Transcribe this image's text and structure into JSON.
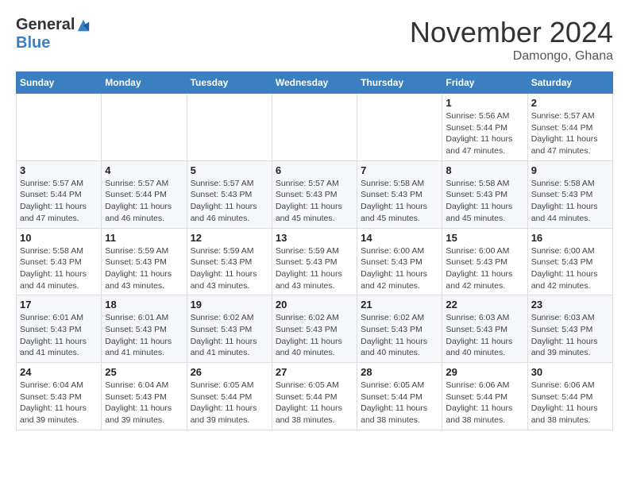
{
  "header": {
    "logo_general": "General",
    "logo_blue": "Blue",
    "month_title": "November 2024",
    "location": "Damongo, Ghana"
  },
  "days_of_week": [
    "Sunday",
    "Monday",
    "Tuesday",
    "Wednesday",
    "Thursday",
    "Friday",
    "Saturday"
  ],
  "weeks": [
    [
      {
        "day": "",
        "info": ""
      },
      {
        "day": "",
        "info": ""
      },
      {
        "day": "",
        "info": ""
      },
      {
        "day": "",
        "info": ""
      },
      {
        "day": "",
        "info": ""
      },
      {
        "day": "1",
        "info": "Sunrise: 5:56 AM\nSunset: 5:44 PM\nDaylight: 11 hours and 47 minutes."
      },
      {
        "day": "2",
        "info": "Sunrise: 5:57 AM\nSunset: 5:44 PM\nDaylight: 11 hours and 47 minutes."
      }
    ],
    [
      {
        "day": "3",
        "info": "Sunrise: 5:57 AM\nSunset: 5:44 PM\nDaylight: 11 hours and 47 minutes."
      },
      {
        "day": "4",
        "info": "Sunrise: 5:57 AM\nSunset: 5:44 PM\nDaylight: 11 hours and 46 minutes."
      },
      {
        "day": "5",
        "info": "Sunrise: 5:57 AM\nSunset: 5:43 PM\nDaylight: 11 hours and 46 minutes."
      },
      {
        "day": "6",
        "info": "Sunrise: 5:57 AM\nSunset: 5:43 PM\nDaylight: 11 hours and 45 minutes."
      },
      {
        "day": "7",
        "info": "Sunrise: 5:58 AM\nSunset: 5:43 PM\nDaylight: 11 hours and 45 minutes."
      },
      {
        "day": "8",
        "info": "Sunrise: 5:58 AM\nSunset: 5:43 PM\nDaylight: 11 hours and 45 minutes."
      },
      {
        "day": "9",
        "info": "Sunrise: 5:58 AM\nSunset: 5:43 PM\nDaylight: 11 hours and 44 minutes."
      }
    ],
    [
      {
        "day": "10",
        "info": "Sunrise: 5:58 AM\nSunset: 5:43 PM\nDaylight: 11 hours and 44 minutes."
      },
      {
        "day": "11",
        "info": "Sunrise: 5:59 AM\nSunset: 5:43 PM\nDaylight: 11 hours and 43 minutes."
      },
      {
        "day": "12",
        "info": "Sunrise: 5:59 AM\nSunset: 5:43 PM\nDaylight: 11 hours and 43 minutes."
      },
      {
        "day": "13",
        "info": "Sunrise: 5:59 AM\nSunset: 5:43 PM\nDaylight: 11 hours and 43 minutes."
      },
      {
        "day": "14",
        "info": "Sunrise: 6:00 AM\nSunset: 5:43 PM\nDaylight: 11 hours and 42 minutes."
      },
      {
        "day": "15",
        "info": "Sunrise: 6:00 AM\nSunset: 5:43 PM\nDaylight: 11 hours and 42 minutes."
      },
      {
        "day": "16",
        "info": "Sunrise: 6:00 AM\nSunset: 5:43 PM\nDaylight: 11 hours and 42 minutes."
      }
    ],
    [
      {
        "day": "17",
        "info": "Sunrise: 6:01 AM\nSunset: 5:43 PM\nDaylight: 11 hours and 41 minutes."
      },
      {
        "day": "18",
        "info": "Sunrise: 6:01 AM\nSunset: 5:43 PM\nDaylight: 11 hours and 41 minutes."
      },
      {
        "day": "19",
        "info": "Sunrise: 6:02 AM\nSunset: 5:43 PM\nDaylight: 11 hours and 41 minutes."
      },
      {
        "day": "20",
        "info": "Sunrise: 6:02 AM\nSunset: 5:43 PM\nDaylight: 11 hours and 40 minutes."
      },
      {
        "day": "21",
        "info": "Sunrise: 6:02 AM\nSunset: 5:43 PM\nDaylight: 11 hours and 40 minutes."
      },
      {
        "day": "22",
        "info": "Sunrise: 6:03 AM\nSunset: 5:43 PM\nDaylight: 11 hours and 40 minutes."
      },
      {
        "day": "23",
        "info": "Sunrise: 6:03 AM\nSunset: 5:43 PM\nDaylight: 11 hours and 39 minutes."
      }
    ],
    [
      {
        "day": "24",
        "info": "Sunrise: 6:04 AM\nSunset: 5:43 PM\nDaylight: 11 hours and 39 minutes."
      },
      {
        "day": "25",
        "info": "Sunrise: 6:04 AM\nSunset: 5:43 PM\nDaylight: 11 hours and 39 minutes."
      },
      {
        "day": "26",
        "info": "Sunrise: 6:05 AM\nSunset: 5:44 PM\nDaylight: 11 hours and 39 minutes."
      },
      {
        "day": "27",
        "info": "Sunrise: 6:05 AM\nSunset: 5:44 PM\nDaylight: 11 hours and 38 minutes."
      },
      {
        "day": "28",
        "info": "Sunrise: 6:05 AM\nSunset: 5:44 PM\nDaylight: 11 hours and 38 minutes."
      },
      {
        "day": "29",
        "info": "Sunrise: 6:06 AM\nSunset: 5:44 PM\nDaylight: 11 hours and 38 minutes."
      },
      {
        "day": "30",
        "info": "Sunrise: 6:06 AM\nSunset: 5:44 PM\nDaylight: 11 hours and 38 minutes."
      }
    ]
  ]
}
